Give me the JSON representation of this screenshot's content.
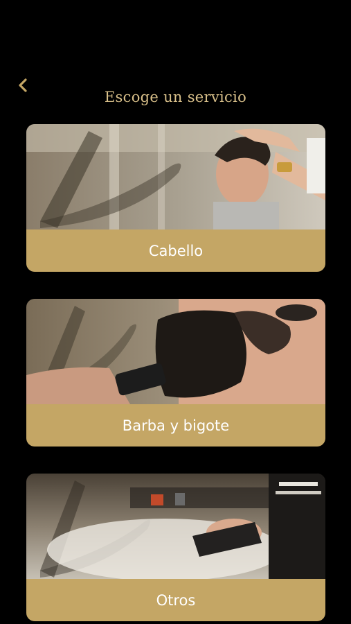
{
  "header": {
    "back_icon": "chevron-left-icon",
    "title": "Escoge un servicio"
  },
  "colors": {
    "background": "#000000",
    "accent_gold": "#c4a665",
    "title_gold": "#d9c08a",
    "label_text": "#ffffff"
  },
  "services": [
    {
      "label": "Cabello",
      "image": "haircut-photo"
    },
    {
      "label": "Barba y bigote",
      "image": "beard-trim-photo"
    },
    {
      "label": "Otros",
      "image": "barbershop-towel-photo"
    }
  ]
}
